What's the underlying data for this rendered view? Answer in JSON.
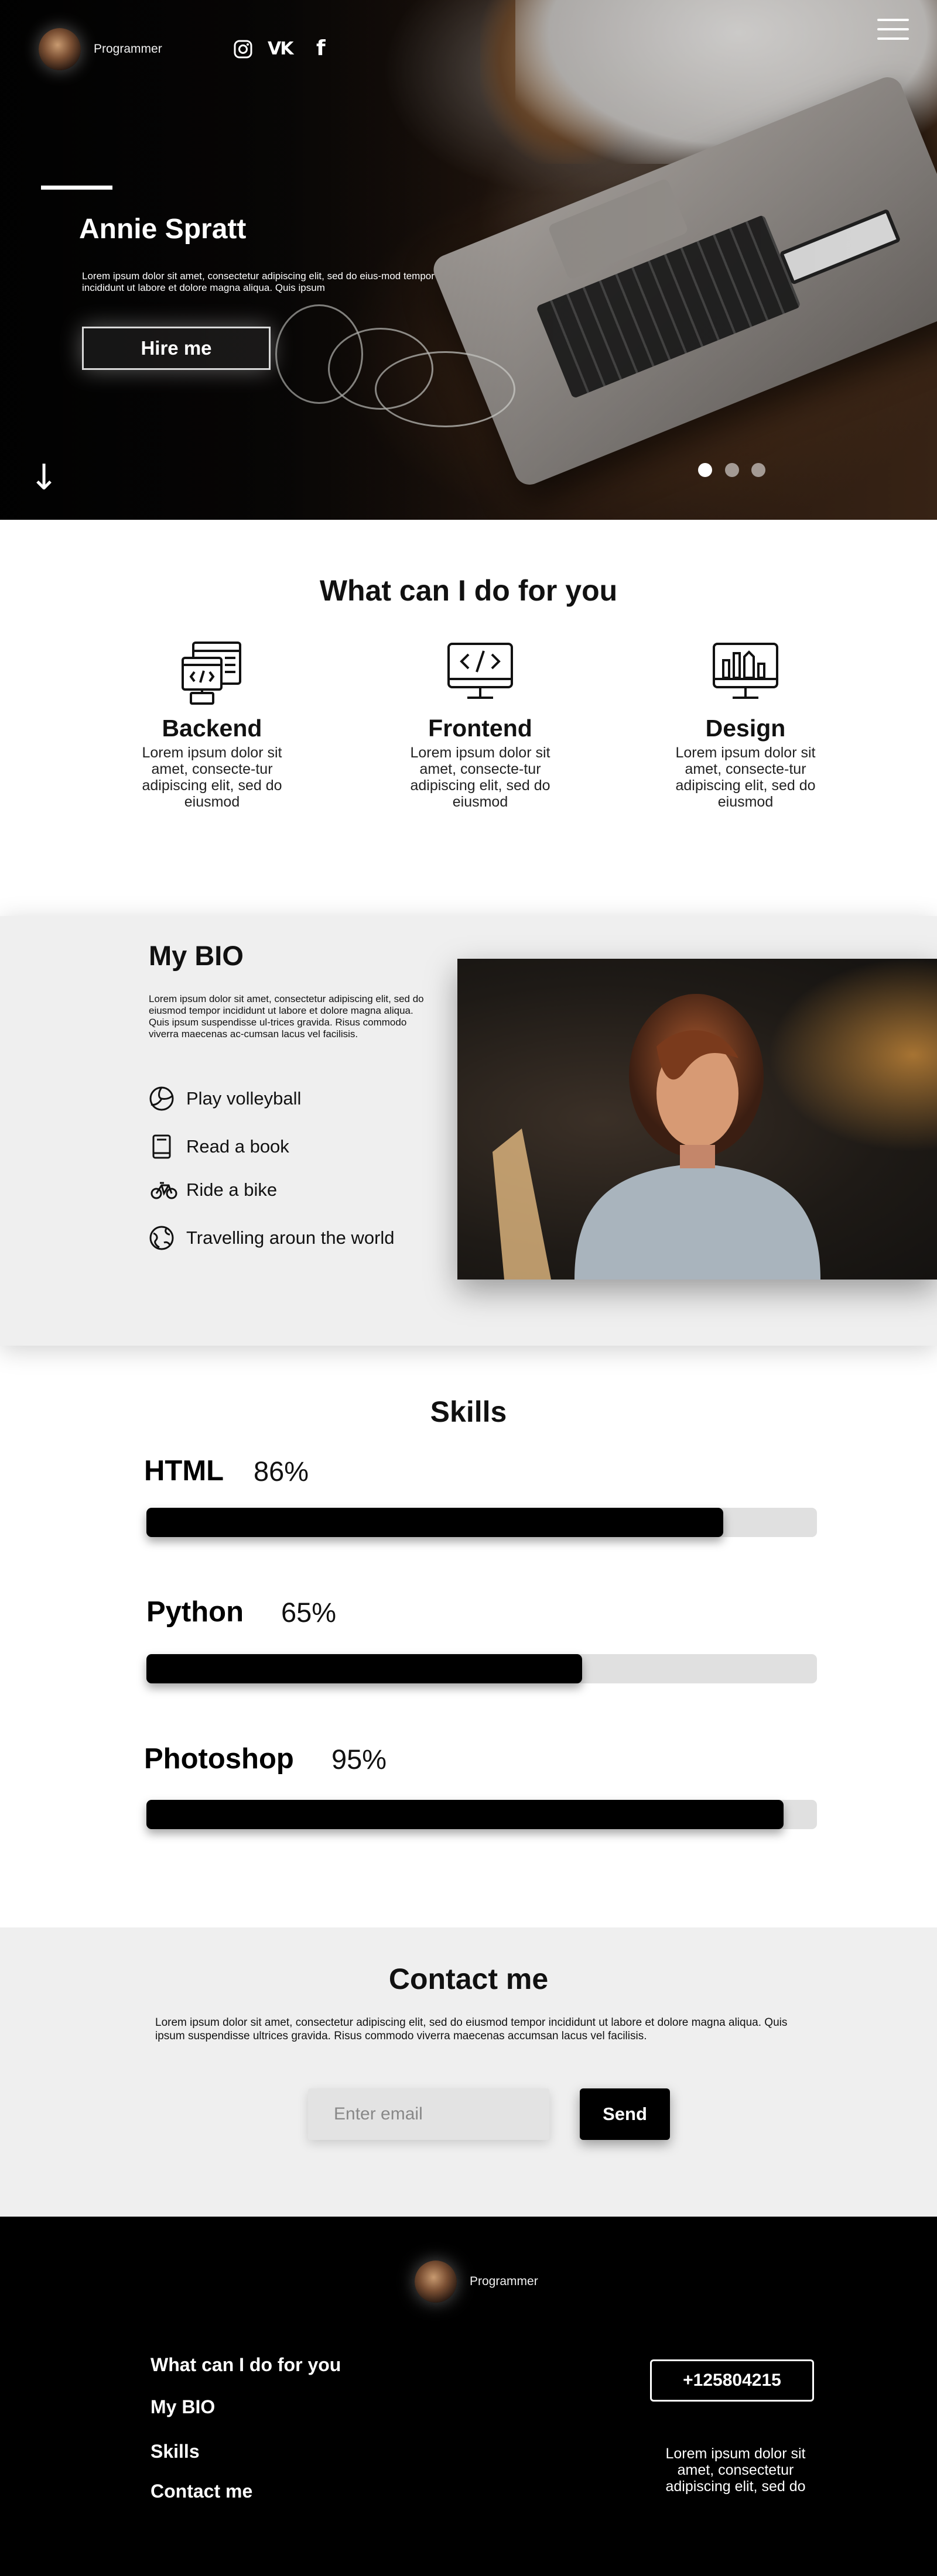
{
  "header": {
    "brand": "Programmer",
    "social_icons": [
      "instagram-icon",
      "vk-icon",
      "facebook-icon"
    ],
    "social_glyphs": {
      "instagram": "◎",
      "vk": "VK",
      "facebook": "f"
    },
    "menu_icon": "hamburger-icon"
  },
  "hero": {
    "title": "Annie Spratt",
    "text": "Lorem ipsum dolor sit amet, consectetur adipiscing elit, sed do eius-mod tempor incididunt ut labore et dolore magna aliqua. Quis ipsum",
    "button": "Hire me",
    "scroll_icon": "↓",
    "slides": 3,
    "active_slide": 1
  },
  "services": {
    "title": "What can I do for you",
    "items": [
      {
        "name": "Backend",
        "text": "Lorem ipsum dolor sit amet, consecte-tur adipiscing elit, sed do eiusmod",
        "icon": "backend-code-icon"
      },
      {
        "name": "Frontend",
        "text": "Lorem ipsum dolor sit amet, consecte-tur adipiscing elit, sed do eiusmod",
        "icon": "monitor-code-icon"
      },
      {
        "name": "Design",
        "text": "Lorem ipsum dolor sit amet, consecte-tur adipiscing elit, sed do eiusmod",
        "icon": "monitor-design-icon"
      }
    ]
  },
  "bio": {
    "title": "My BIO",
    "text": "Lorem ipsum dolor sit amet, consectetur adipiscing elit, sed do eiusmod tempor incididunt ut labore et dolore magna aliqua. Quis ipsum suspendisse ul-trices gravida. Risus commodo viverra maecenas ac-cumsan lacus vel facilisis.",
    "hobbies": [
      {
        "label": "Play volleyball",
        "icon": "volleyball-icon"
      },
      {
        "label": "Read a book",
        "icon": "book-icon"
      },
      {
        "label": "Ride a bike",
        "icon": "bike-icon"
      },
      {
        "label": "Travelling aroun the world",
        "icon": "globe-icon"
      }
    ]
  },
  "skills": {
    "title": "Skills",
    "items": [
      {
        "name": "HTML",
        "percent_label": "86%",
        "level": 0.86
      },
      {
        "name": "Python",
        "percent_label": "65%",
        "level": 0.65
      },
      {
        "name": "Photoshop",
        "percent_label": "95%",
        "level": 0.95
      }
    ]
  },
  "contact": {
    "title": "Contact me",
    "text": "Lorem ipsum dolor sit amet, consectetur adipiscing elit, sed do eiusmod tempor incididunt ut labore et dolore magna aliqua. Quis ipsum suspendisse ultrices gravida. Risus commodo viverra maecenas accumsan lacus vel facilisis.",
    "email_placeholder": "Enter email",
    "send": "Send"
  },
  "footer": {
    "brand": "Programmer",
    "links": [
      "What can I do for you",
      "My BIO",
      "Skills",
      "Contact me"
    ],
    "phone": "+125804215",
    "text": "Lorem ipsum dolor sit amet, consectetur adipiscing elit, sed do"
  },
  "colors": {
    "accent": "#000000",
    "section_bg": "#efefef",
    "track": "#e0e0e0"
  }
}
